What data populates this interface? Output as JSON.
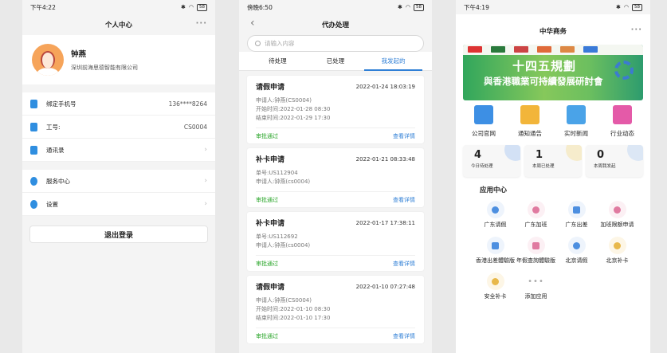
{
  "colors": {
    "accent": "#2f7fd6",
    "approved": "#2aa62a",
    "avatar": "#f6a45a"
  },
  "screen1": {
    "status_time": "下午4:22",
    "battery": "58",
    "title": "个人中心",
    "more": "···",
    "user": {
      "name": "钟燕",
      "company": "深圳前海思德智能有限公司"
    },
    "rows": [
      {
        "label": "绑定手机号",
        "value": "136****8264",
        "icon": "phone-icon"
      },
      {
        "label": "工号:",
        "value": "CS0004",
        "icon": "badge-icon"
      },
      {
        "label": "通讯录",
        "value": "",
        "icon": "contacts-icon"
      }
    ],
    "rows2": [
      {
        "label": "服务中心",
        "icon": "bulb-icon"
      },
      {
        "label": "设置",
        "icon": "gear-icon"
      }
    ],
    "chevron": "›",
    "logout": "退出登录"
  },
  "screen2": {
    "status_time": "傍晚6:50",
    "battery": "58",
    "title": "代办处理",
    "back": "‹",
    "search_placeholder": "请输入内容",
    "tabs": [
      "待处理",
      "已处理",
      "我发起的"
    ],
    "cards": [
      {
        "title": "请假申请",
        "date": "2022-01-24 18:03:19",
        "lines": [
          "申请人:钟燕(CS0004)",
          "开始时间:2022-01-28 08:30",
          "结束时间:2022-01-29 17:30"
        ],
        "status": "审批通过",
        "action": "查看详情"
      },
      {
        "title": "补卡申请",
        "date": "2022-01-21 08:33:48",
        "lines": [
          "单号:US112904",
          "申请人:钟燕(cs0004)"
        ],
        "status": "审批通过",
        "action": "查看详情"
      },
      {
        "title": "补卡申请",
        "date": "2022-01-17 17:38:11",
        "lines": [
          "单号:US112692",
          "申请人:钟燕(cs0004)"
        ],
        "status": "审批通过",
        "action": "查看详情"
      },
      {
        "title": "请假申请",
        "date": "2022-01-10 07:27:48",
        "lines": [
          "申请人:钟燕(CS0004)",
          "开始时间:2022-01-10 08:30",
          "结束时间:2022-01-10 17:30"
        ],
        "status": "审批通过",
        "action": "查看详情"
      }
    ]
  },
  "screen3": {
    "status_time": "下午4:19",
    "battery": "58",
    "title": "中华商务",
    "more": "···",
    "banner": {
      "line1": "十四五規劃",
      "line2": "與香港職業可持續發展研討會"
    },
    "shortcuts": [
      {
        "label": "公司官网",
        "icon": "building-icon",
        "color": "#3d8fe4"
      },
      {
        "label": "通知通告",
        "icon": "notice-icon",
        "color": "#f2b53a"
      },
      {
        "label": "实时新闻",
        "icon": "news-icon",
        "color": "#4aa3e8"
      },
      {
        "label": "行业动态",
        "icon": "trend-icon",
        "color": "#e45aa8"
      }
    ],
    "stats": [
      {
        "num": "4",
        "label": "今日待处理",
        "color": "#8fb7f0"
      },
      {
        "num": "1",
        "label": "本周已处理",
        "color": "#f3d67a"
      },
      {
        "num": "0",
        "label": "本周我发起",
        "color": "#a8c8f0"
      }
    ],
    "section": "应用中心",
    "apps": [
      {
        "label": "广东请假",
        "icon": "person-icon",
        "color": "#4d8fe0"
      },
      {
        "label": "广东加班",
        "icon": "person-clock-icon",
        "color": "#e07aa0"
      },
      {
        "label": "广东出差",
        "icon": "suitcase-icon",
        "color": "#4d8fe0"
      },
      {
        "label": "加班限额申请",
        "icon": "person-badge-icon",
        "color": "#e07aa0"
      },
      {
        "label": "香港出差體驗版",
        "icon": "briefcase-icon",
        "color": "#4d8fe0"
      },
      {
        "label": "年假查詢體驗版",
        "icon": "calendar-icon",
        "color": "#e07aa0"
      },
      {
        "label": "北京请假",
        "icon": "person-icon",
        "color": "#4d8fe0"
      },
      {
        "label": "北京补卡",
        "icon": "hand-icon",
        "color": "#e8b84a"
      },
      {
        "label": "安全补卡",
        "icon": "hand-icon",
        "color": "#e8b84a"
      },
      {
        "label": "添加应用",
        "icon": "more-icon",
        "color": "#aaaaaa"
      }
    ]
  }
}
